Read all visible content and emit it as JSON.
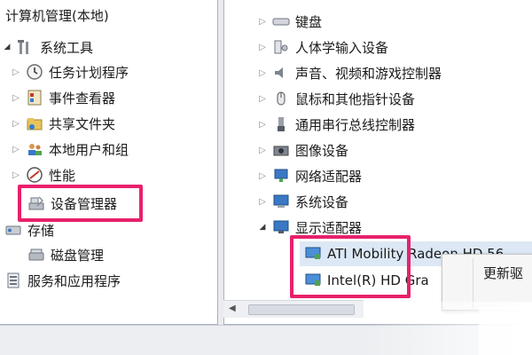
{
  "left_tree": {
    "root": "计算机管理(本地)",
    "system_tools": "系统工具",
    "task_scheduler": "任务计划程序",
    "event_viewer": "事件查看器",
    "shared_folders": "共享文件夹",
    "local_users": "本地用户和组",
    "performance": "性能",
    "device_manager": "设备管理器",
    "storage": "存储",
    "disk_management": "磁盘管理",
    "services": "服务和应用程序"
  },
  "device_tree": {
    "keyboard": "键盘",
    "hid": "人体学输入设备",
    "sound": "声音、视频和游戏控制器",
    "mouse": "鼠标和其他指针设备",
    "usb": "通用串行总线控制器",
    "imaging": "图像设备",
    "network": "网络适配器",
    "system": "系统设备",
    "display": "显示适配器",
    "ati": "ATI Mobility Radeon HD 56",
    "intel": "Intel(R) HD Gra"
  },
  "context_menu": {
    "update_driver": "更新驱"
  },
  "colors": {
    "highlight": "#e8216b",
    "selection": "#dce8f5"
  }
}
